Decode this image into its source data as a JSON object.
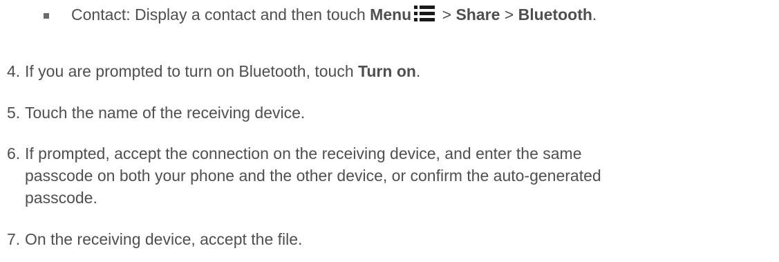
{
  "bullet_item": {
    "prefix": "Contact: Display a contact and then touch ",
    "menu_label": "Menu",
    "icon": "menu-icon",
    "sep1": " > ",
    "share_label": "Share",
    "sep2": " > ",
    "bluetooth_label": "Bluetooth",
    "end": "."
  },
  "steps": [
    {
      "number": "4.",
      "text": "If you are prompted to turn on Bluetooth, touch ",
      "bold": "Turn on",
      "end": "."
    },
    {
      "number": "5.",
      "text": "Touch the name of the receiving device."
    },
    {
      "number": "6.",
      "lines": [
        "If prompted, accept the connection on the receiving device, and enter the same",
        "passcode on both your phone and the other device, or confirm the auto-generated",
        "passcode."
      ]
    },
    {
      "number": "7.",
      "text": "On the receiving device, accept the file."
    }
  ]
}
